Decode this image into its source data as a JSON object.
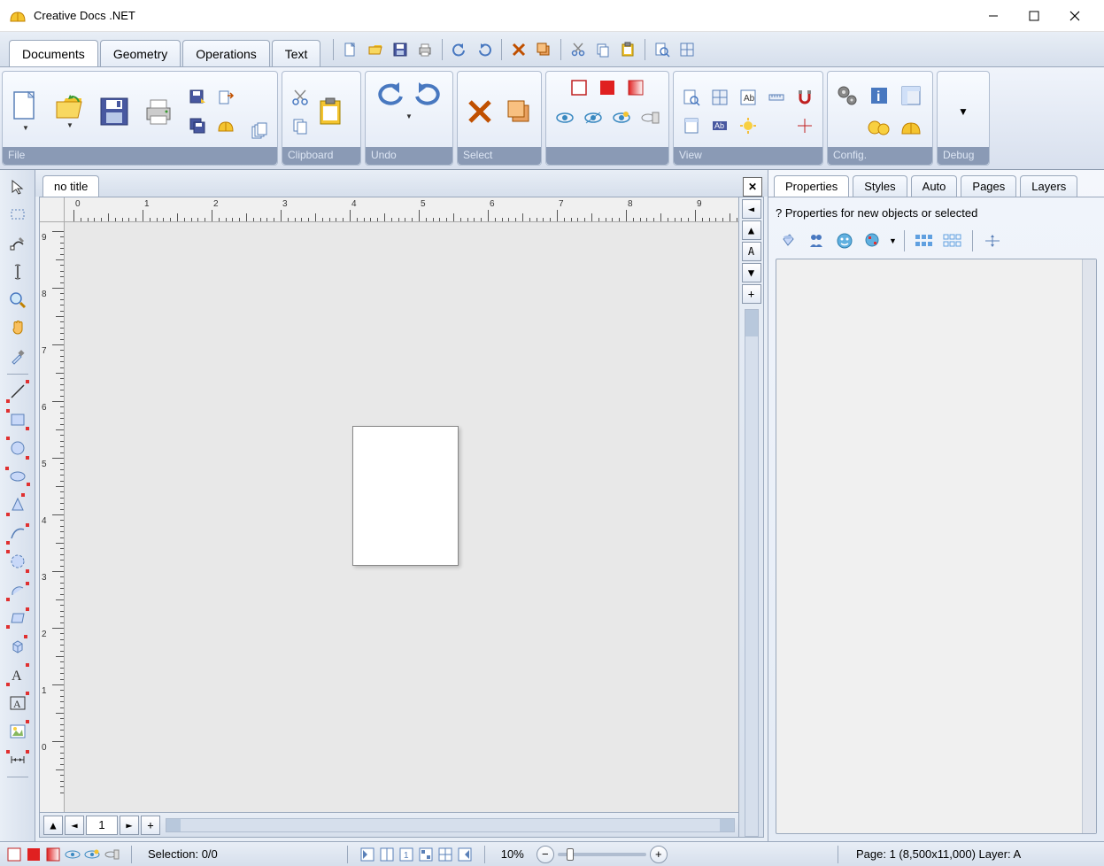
{
  "app": {
    "title": "Creative Docs .NET"
  },
  "menu": {
    "tabs": [
      "Documents",
      "Geometry",
      "Operations",
      "Text"
    ],
    "active": 0
  },
  "ribbon": {
    "groups": {
      "file": "File",
      "clipboard": "Clipboard",
      "undo": "Undo",
      "select": "Select",
      "view": "View",
      "config": "Config.",
      "debug": "Debug"
    }
  },
  "document": {
    "tab_title": "no title",
    "page_number": "1",
    "zoom_percent": "10%"
  },
  "side": {
    "tabs": [
      "Properties",
      "Styles",
      "Auto",
      "Pages",
      "Layers"
    ],
    "active": 0,
    "hint": "? Properties for new objects or selected"
  },
  "status": {
    "selection": "Selection: 0/0",
    "page_info": "Page: 1 (8,500x11,000)  Layer: A"
  },
  "ruler": {
    "h_labels": [
      "0",
      "1",
      "2",
      "3",
      "4",
      "5",
      "6",
      "7",
      "8",
      "9"
    ],
    "v_labels": [
      "9",
      "8",
      "7",
      "6",
      "5",
      "4",
      "3",
      "2",
      "1",
      "0"
    ]
  },
  "right_strip": {
    "letter": "A"
  }
}
